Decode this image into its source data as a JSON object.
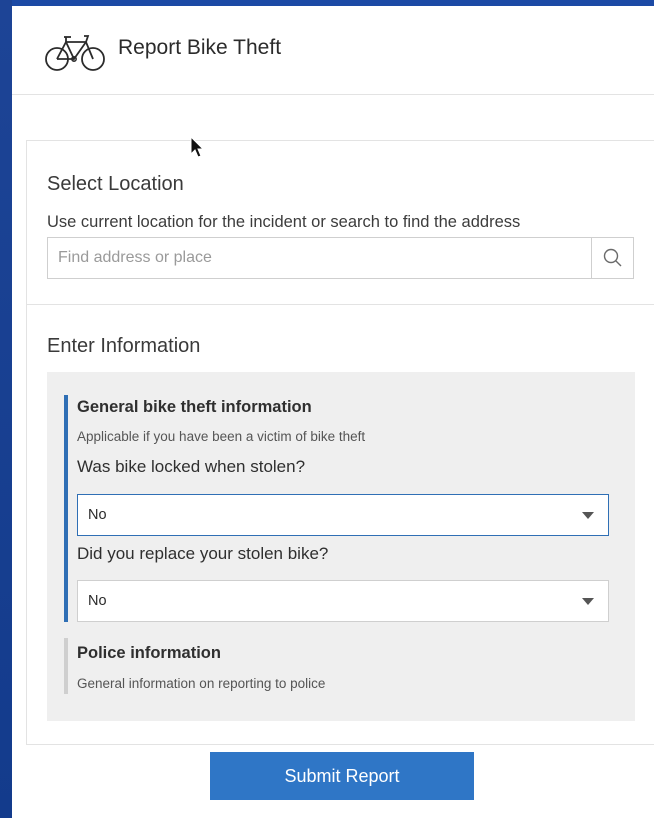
{
  "app": {
    "title": "Report Bike Theft",
    "icon": "bicycle-icon"
  },
  "location": {
    "heading": "Select Location",
    "instructions": "Use current location for the incident or search to find the address",
    "search_placeholder": "Find address or place",
    "search_value": "",
    "search_icon": "search-icon"
  },
  "info": {
    "heading": "Enter Information",
    "groups": [
      {
        "title": "General bike theft information",
        "description": "Applicable if you have been a victim of bike theft",
        "expanded": true,
        "fields": [
          {
            "label": "Was bike locked when stolen?",
            "value": "No",
            "focused": true
          },
          {
            "label": "Did you replace your stolen bike?",
            "value": "No",
            "focused": false
          }
        ]
      },
      {
        "title": "Police information",
        "description": "General information on reporting to police",
        "expanded": false
      }
    ]
  },
  "actions": {
    "submit_label": "Submit Report"
  },
  "colors": {
    "background": "#163a8a",
    "accent": "#2f76c6",
    "group_active_bar": "#2f6fb5",
    "group_inactive_bar": "#cfcfcf"
  }
}
